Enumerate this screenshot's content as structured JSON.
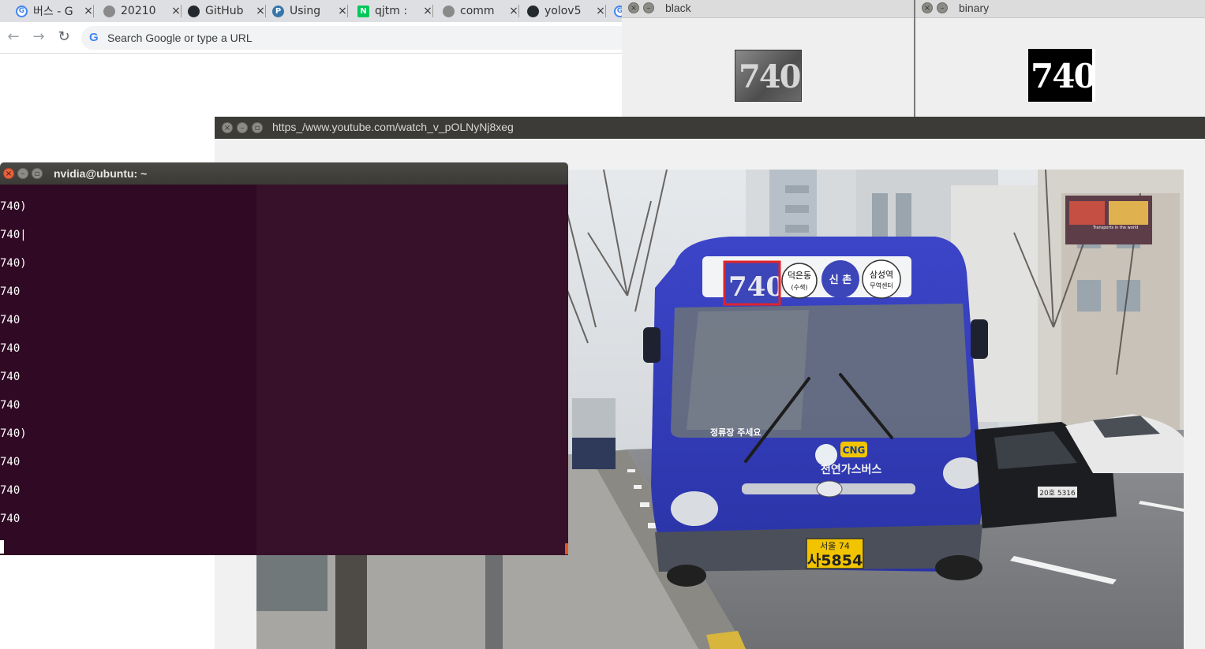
{
  "chrome": {
    "tabs": [
      {
        "icon": "google-icon",
        "label": "버스 - G",
        "color": "#4285f4"
      },
      {
        "icon": "globe-icon",
        "label": "20210",
        "color": "#8a8a8a"
      },
      {
        "icon": "github-icon",
        "label": "GitHub",
        "color": "#24292e"
      },
      {
        "icon": "python-icon",
        "label": "Using",
        "color": "#3776ab"
      },
      {
        "icon": "naver-icon",
        "label": "qjtm :",
        "color": "#03c75a"
      },
      {
        "icon": "globe-icon",
        "label": "comm",
        "color": "#8a8a8a"
      },
      {
        "icon": "github-icon",
        "label": "yolov5",
        "color": "#24292e"
      },
      {
        "icon": "google-icon",
        "label": "",
        "color": "#4285f4"
      }
    ],
    "tab_close": "×",
    "omnibox": {
      "placeholder": "Search Google or type a URL",
      "g": "G"
    }
  },
  "opencv": {
    "black_title": "black",
    "binary_title": "binary",
    "plate_text": "740"
  },
  "video": {
    "title": "https_/www.youtube.com/watch_v_pOLNyNj8xeg",
    "route_number": "740",
    "sign_destination_1": "덕은동",
    "sign_destination_1_sub": "(수색)",
    "sign_destination_2": "신 촌",
    "sign_destination_3": "삼성역",
    "sign_destination_3_sub": "무역센터",
    "side_banner": "정류장 주세요",
    "cng": "CNG",
    "company": "천연가스버스",
    "plate_top": "서울 74",
    "plate_bottom": "사5854",
    "car_plate": "20호 5316",
    "thumb_text": "Transports in the world"
  },
  "terminal": {
    "title": "nvidia@ubuntu: ~",
    "lines": [
      "740)",
      "740|",
      "740)",
      "740",
      "740",
      "740",
      "740",
      "740",
      "740)",
      "740",
      "740",
      "740"
    ]
  }
}
